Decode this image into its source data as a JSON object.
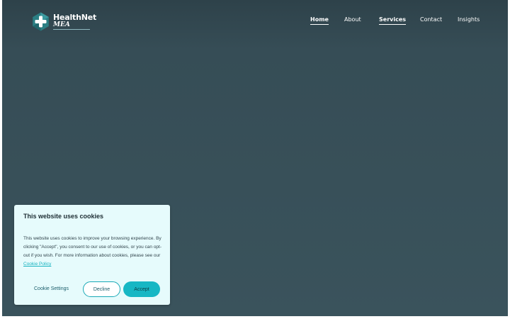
{
  "header": {
    "logo": {
      "name": "HealthNet",
      "sub": "MEA",
      "icon": "plus-cross-icon",
      "badge_color": "#2b7f84"
    },
    "nav": [
      {
        "label": "Home",
        "active": true
      },
      {
        "label": "About",
        "active": false
      },
      {
        "label": "Services",
        "active": true
      },
      {
        "label": "Contact",
        "active": false
      },
      {
        "label": "Insights",
        "active": false
      }
    ]
  },
  "cookie_banner": {
    "title": "This website uses cookies",
    "body": "This website uses cookies to improve your browsing experience. By clicking \"Accept\", you consent to our use of cookies, or you can opt-out if you wish. For more information about cookies, please see our",
    "link_label": "Cookie Policy",
    "settings_label": "Cookie Settings",
    "decline_label": "Decline",
    "accept_label": "Accept"
  },
  "colors": {
    "background": "#3a535c",
    "accent": "#17b7c4",
    "banner": "#e6fbfc"
  }
}
